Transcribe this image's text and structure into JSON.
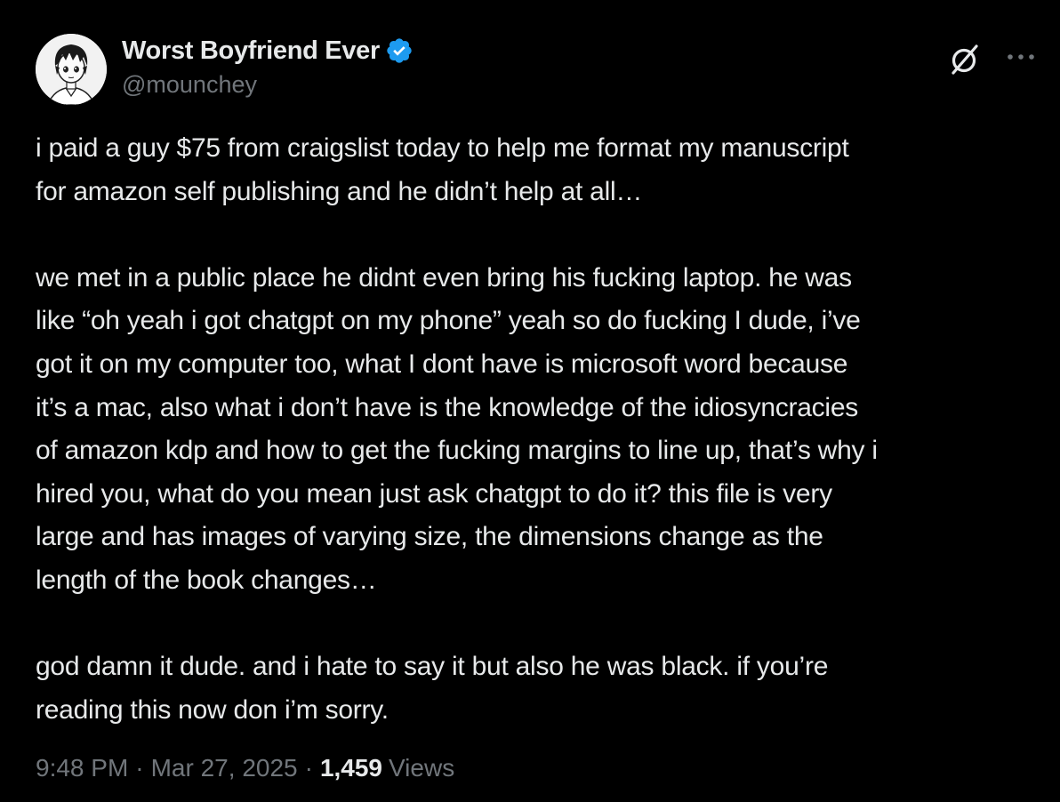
{
  "author": {
    "display_name": "Worst Boyfriend Ever",
    "handle": "@mounchey",
    "verified": true,
    "avatar_icon": "anime-boy-avatar"
  },
  "header_actions": {
    "grok_icon": "grok-icon",
    "more_icon": "more-icon"
  },
  "tweet": {
    "paragraphs": [
      "i paid a guy $75 from craigslist today to help me format my manuscript\nfor amazon self publishing and he didn’t help at all…",
      "we met in a public place he didnt even bring his fucking laptop. he was\nlike “oh yeah i got chatgpt on my phone” yeah so do fucking I dude, i’ve\ngot it on my computer too, what I dont have is microsoft word because\nit’s a mac, also what i don’t have is the knowledge of the idiosyncracies\nof amazon kdp and how to get the fucking margins to line up, that’s why i\nhired you, what do you mean just ask chatgpt to do it? this file is very\nlarge and has images of varying size, the dimensions change as the\nlength of the book changes…",
      "god damn it dude. and i hate to say it but also he was black. if you’re\nreading this now don i’m sorry."
    ]
  },
  "meta": {
    "time": "9:48 PM",
    "separator": "·",
    "date": "Mar 27, 2025",
    "views_count": "1,459",
    "views_label": "Views"
  },
  "colors": {
    "background": "#000000",
    "text": "#e7e9ea",
    "secondary_text": "#71767b",
    "verified_blue": "#1d9bf0"
  }
}
